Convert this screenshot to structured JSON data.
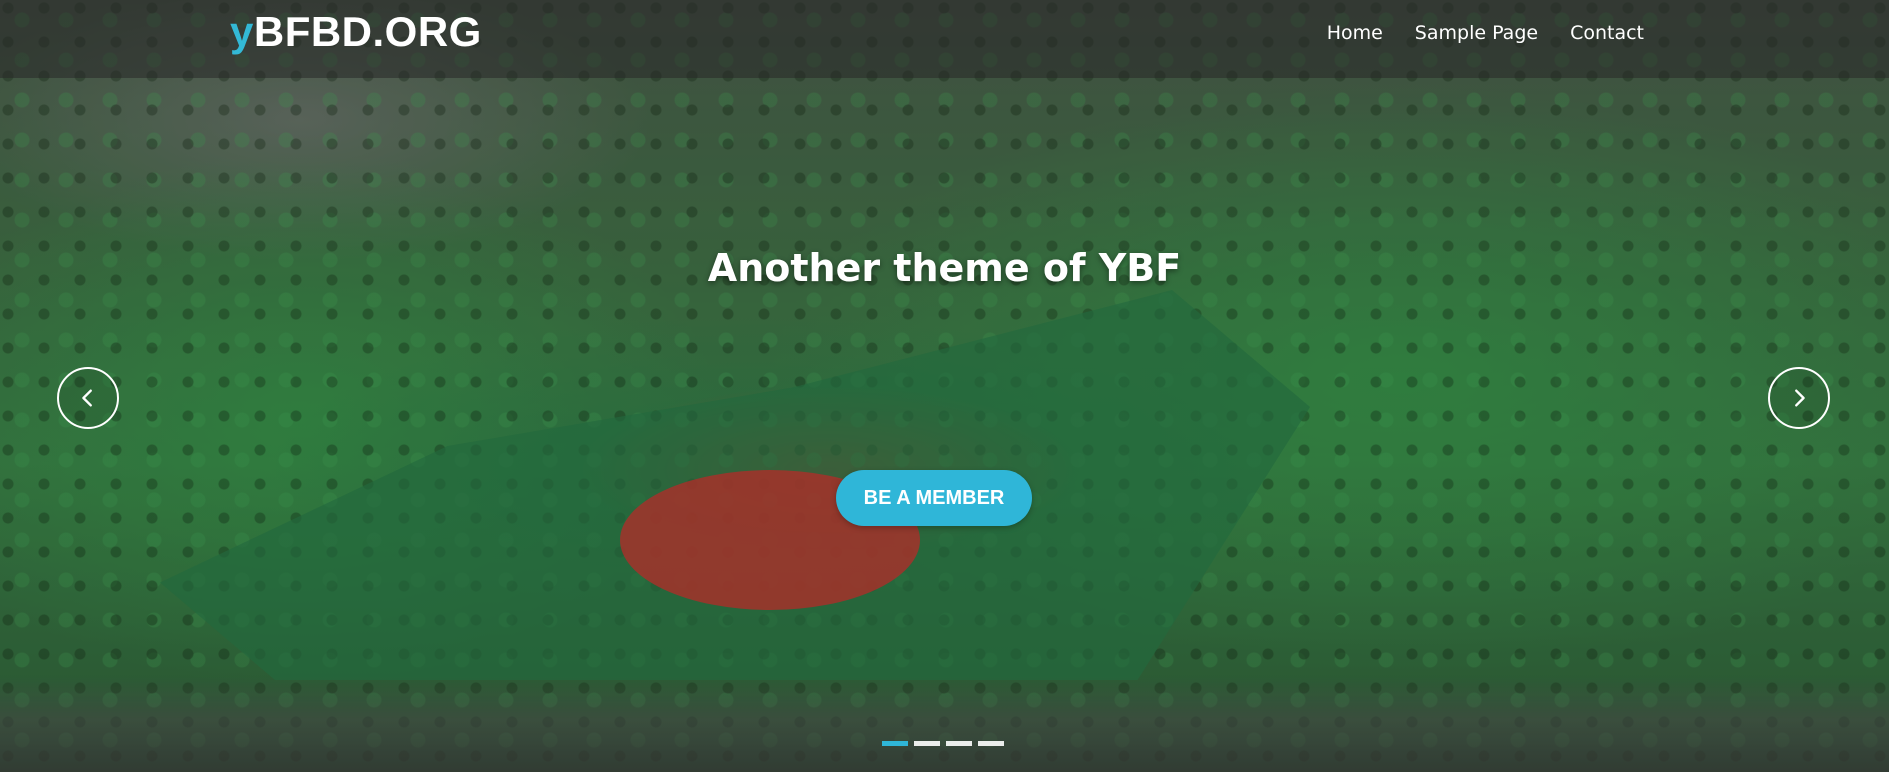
{
  "brand": {
    "prefix": "y",
    "rest": "BFBD.ORG"
  },
  "nav": {
    "items": [
      "Home",
      "Sample Page",
      "Contact"
    ]
  },
  "slide": {
    "caption": "Another theme of YBF",
    "cta_label": "BE A MEMBER"
  },
  "carousel": {
    "prev_icon": "chevron-left-icon",
    "next_icon": "chevron-right-icon",
    "indicator_count": 4,
    "active_index": 0
  },
  "colors": {
    "accent": "#2fb6d8",
    "nav_overlay": "rgba(40,40,40,0.55)",
    "text": "#ffffff"
  }
}
